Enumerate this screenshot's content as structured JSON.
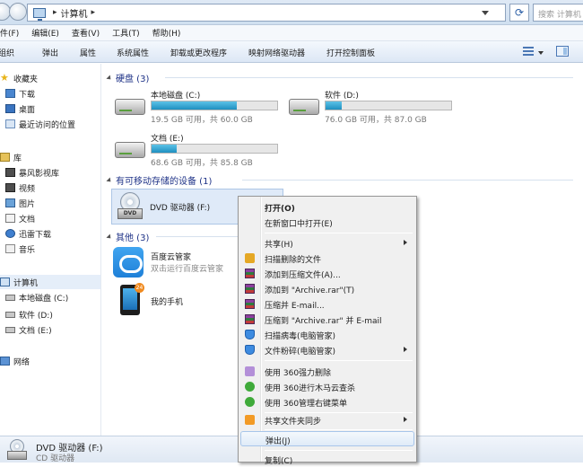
{
  "address": {
    "path": "计算机",
    "search_placeholder": "搜索 计算机"
  },
  "menubar": {
    "items": [
      "件(F)",
      "编辑(E)",
      "查看(V)",
      "工具(T)",
      "帮助(H)"
    ]
  },
  "toolbar": {
    "items": [
      "组织",
      "弹出",
      "属性",
      "系统属性",
      "卸载或更改程序",
      "映射网络驱动器",
      "打开控制面板"
    ]
  },
  "nav": {
    "favorites": "收藏夹",
    "fav_items": [
      "下载",
      "桌面",
      "最近访问的位置"
    ],
    "library": "库",
    "lib_items": [
      "暴风影视库",
      "视频",
      "图片",
      "文档",
      "迅雷下载",
      "音乐"
    ],
    "computer": "计算机",
    "computer_items": [
      "本地磁盘 (C:)",
      "软件 (D:)",
      "文档 (E:)"
    ],
    "network": "网络"
  },
  "groups": {
    "hdd_title": "硬盘 (3)",
    "removable_title": "有可移动存储的设备 (1)",
    "other_title": "其他 (3)"
  },
  "drives": [
    {
      "name": "本地磁盘 (C:)",
      "space": "19.5 GB 可用，共 60.0 GB",
      "used_fraction": 0.675
    },
    {
      "name": "软件 (D:)",
      "space": "76.0 GB 可用，共 87.0 GB",
      "used_fraction": 0.126
    },
    {
      "name": "文档 (E:)",
      "space": "68.6 GB 可用，共 85.8 GB",
      "used_fraction": 0.2
    }
  ],
  "dvd": {
    "name": "DVD 驱动器 (F:)",
    "icon_label": "DVD"
  },
  "others": [
    {
      "name": "百度云管家",
      "sub": "双击运行百度云管家"
    },
    {
      "name": "我的手机",
      "badge": "24"
    }
  ],
  "status": {
    "name": "DVD 驱动器 (F:)",
    "type": "CD 驱动器"
  },
  "context_menu": {
    "open": "打开(O)",
    "open_new": "在新窗口中打开(E)",
    "share": "共享(H)",
    "scan_delete": "扫描删除的文件",
    "add_archive": "添加到压缩文件(A)...",
    "add_rar": "添加到 \"Archive.rar\"(T)",
    "compress_email": "压缩并 E-mail...",
    "compress_rar_email": "压缩到 \"Archive.rar\" 并 E-mail",
    "virus_scan": "扫描病毒(电脑管家)",
    "shred": "文件粉碎(电脑管家)",
    "force_delete": "使用 360强力删除",
    "trojan_scan": "使用 360进行木马云查杀",
    "manage_menu": "使用 360管理右键菜单",
    "sync": "共享文件夹同步",
    "eject": "弹出(J)",
    "copy": "复制(C)"
  },
  "colors": {
    "bar_fill": "#1f8fc0",
    "group_title": "#1e3287",
    "selection": "#dfeaf8"
  }
}
